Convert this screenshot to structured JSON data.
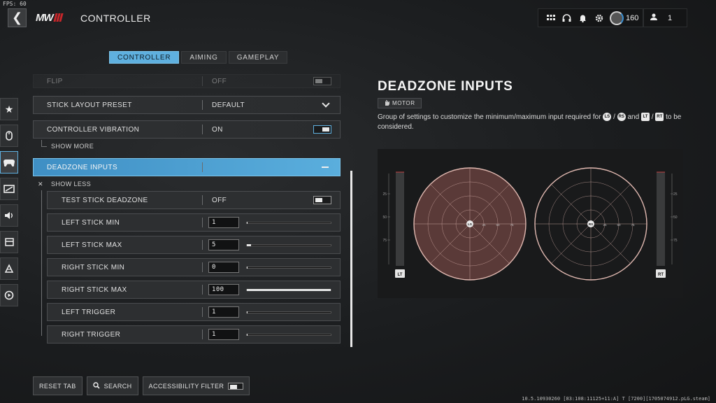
{
  "fps": "FPS: 60",
  "header": {
    "title": "CONTROLLER",
    "logo": "MW"
  },
  "topbar": {
    "level": "160",
    "party_count": "1"
  },
  "tabs": [
    "CONTROLLER",
    "AIMING",
    "GAMEPLAY"
  ],
  "settings": {
    "flip": {
      "label": "FLIP",
      "value": "OFF"
    },
    "stick_layout": {
      "label": "STICK LAYOUT PRESET",
      "value": "DEFAULT"
    },
    "vibration": {
      "label": "CONTROLLER VIBRATION",
      "value": "ON"
    },
    "show_more": "SHOW MORE",
    "deadzone": {
      "label": "DEADZONE INPUTS"
    },
    "show_less": "SHOW LESS",
    "test_stick": {
      "label": "TEST STICK DEADZONE",
      "value": "OFF"
    },
    "rows": [
      {
        "label": "LEFT STICK MIN",
        "value": "1",
        "fill": 0.01
      },
      {
        "label": "LEFT STICK MAX",
        "value": "5",
        "fill": 0.05
      },
      {
        "label": "RIGHT STICK MIN",
        "value": "0",
        "fill": 0.0
      },
      {
        "label": "RIGHT STICK MAX",
        "value": "100",
        "fill": 1.0
      },
      {
        "label": "LEFT TRIGGER",
        "value": "1",
        "fill": 0.01
      },
      {
        "label": "RIGHT TRIGGER",
        "value": "1",
        "fill": 0.01
      }
    ]
  },
  "info": {
    "title": "DEADZONE INPUTS",
    "tag": "MOTOR",
    "desc_a": "Group of settings to customize the minimum/maximum input required for",
    "desc_b": "and",
    "desc_c": "to be considered.",
    "badges": {
      "ls": "LS",
      "rs": "RS",
      "lt": "LT",
      "rt": "RT"
    },
    "sep": "/",
    "viz": {
      "ticks": [
        "25",
        "50",
        "75"
      ],
      "stick_left": "LS",
      "stick_right": "RS",
      "trigger_left": "LT",
      "trigger_right": "RT"
    }
  },
  "bottom": {
    "reset": "RESET TAB",
    "search": "SEARCH",
    "accessibility": "ACCESSIBILITY FILTER"
  },
  "build": "10.5.10930260 [83:108:11125+11:A] T [7200][1705074912.pLG.steam]",
  "colors": {
    "accent": "#5fb0df",
    "stick_fill": "#5a3a38",
    "stick_line": "#e0b8b0"
  }
}
